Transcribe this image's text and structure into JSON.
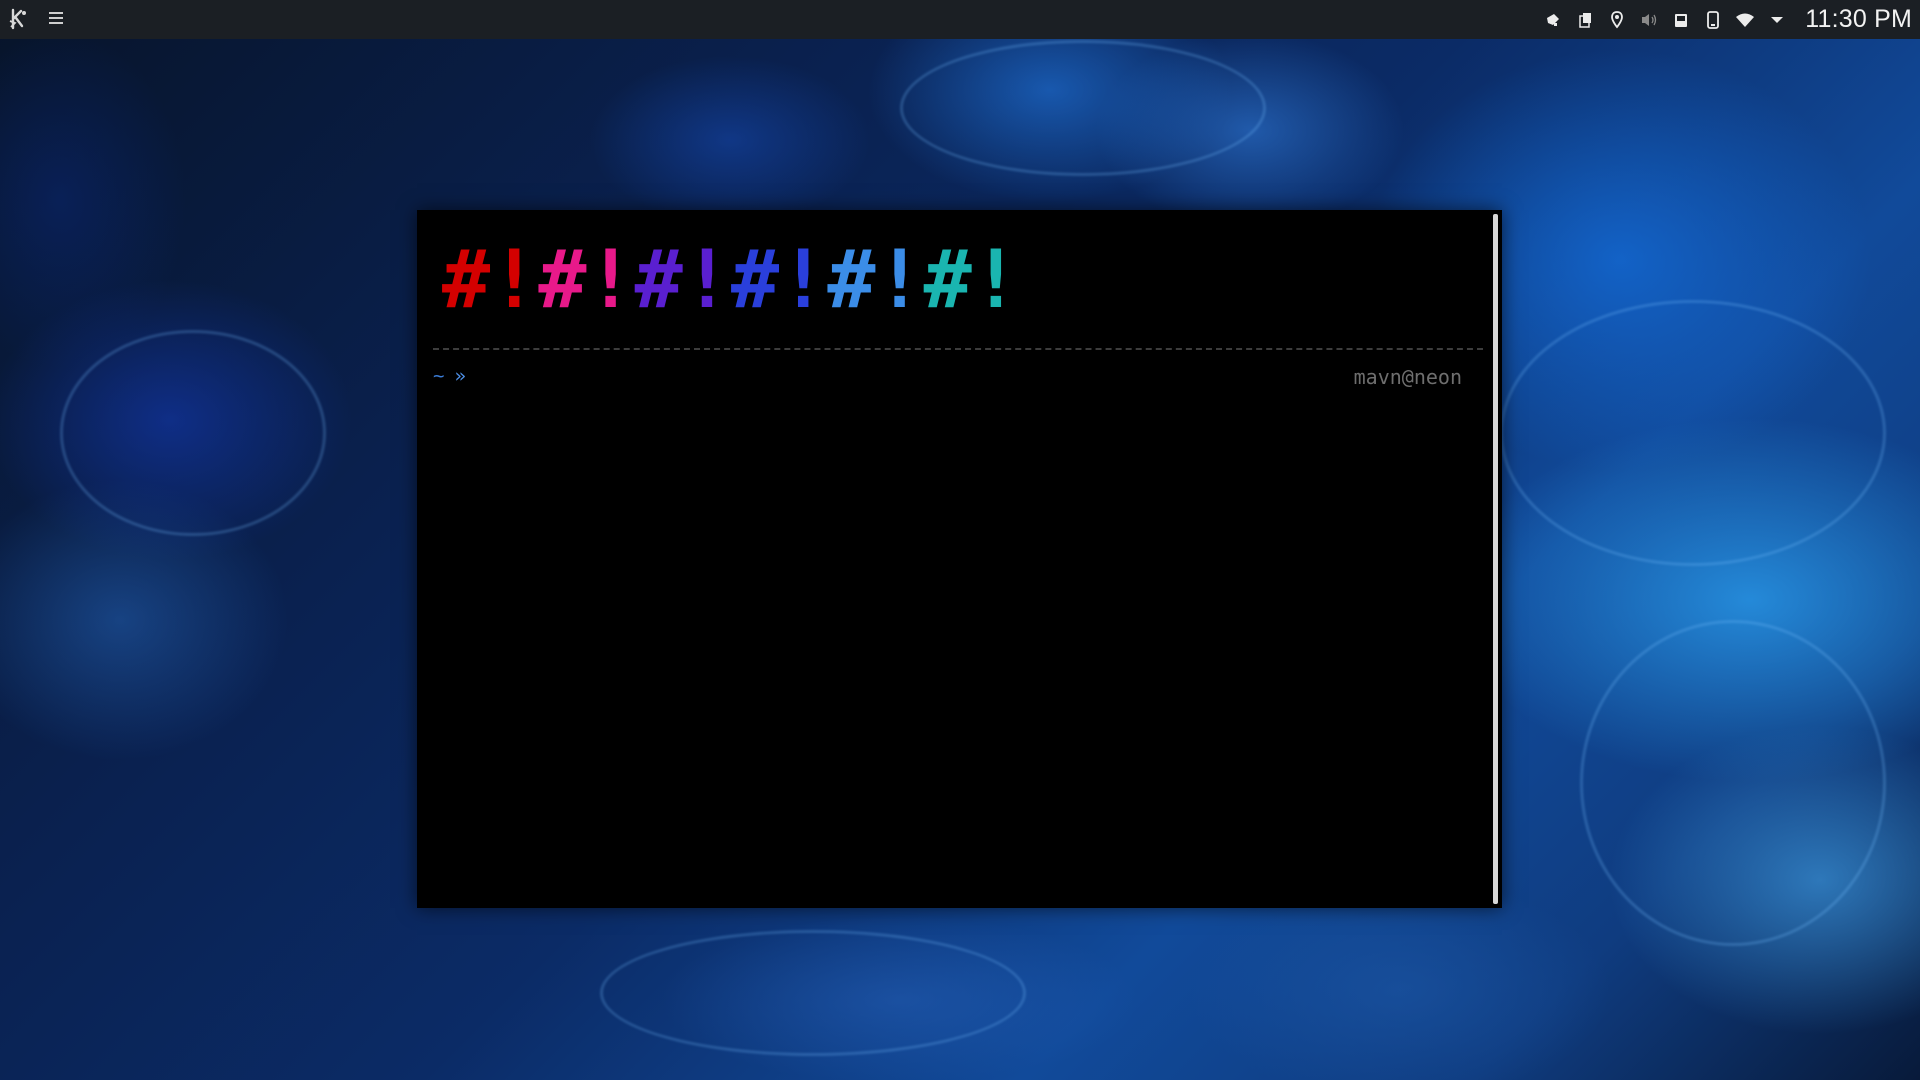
{
  "panel": {
    "clock": "11:30 PM",
    "launcher_icon": "kde-logo-icon",
    "menu_icon": "hamburger-menu-icon",
    "tray_icons": [
      "notifications-icon",
      "clipboard-icon",
      "location-icon",
      "volume-icon",
      "storage-icon",
      "phone-icon",
      "wifi-icon",
      "expand-tray-icon"
    ]
  },
  "terminal": {
    "banner": [
      {
        "text": "#!",
        "color": "#d40000"
      },
      {
        "text": "#!",
        "color": "#e8198a"
      },
      {
        "text": "#!",
        "color": "#5a1fd0"
      },
      {
        "text": "#!",
        "color": "#2a3fdb"
      },
      {
        "text": "#!",
        "color": "#3b8de8"
      },
      {
        "text": "#!",
        "color": "#1ab5b0"
      }
    ],
    "prompt_dir": "~",
    "prompt_symbol": "»",
    "user_host": "mavn@neon"
  }
}
